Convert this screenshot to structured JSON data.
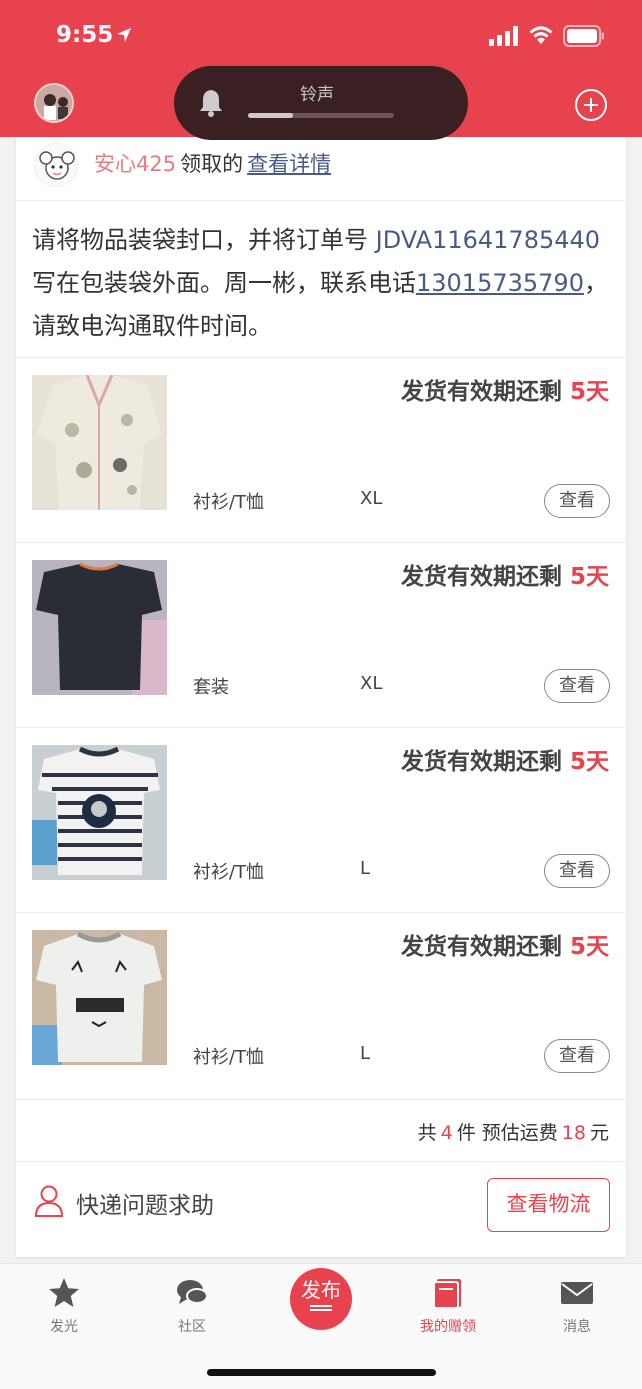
{
  "status_bar": {
    "time": "9:55"
  },
  "ringer_hud": {
    "label": "铃声",
    "level_fraction": 0.31
  },
  "claim": {
    "user": "安心425",
    "verb": "领取的",
    "link": "查看详情"
  },
  "instruction": {
    "text_before": "请将物品装袋封口，并将订单号 ",
    "order_number": "JDVA11641785440",
    "text_middle": " 写在包装袋外面。周一彬，联系电话",
    "phone": "13015735790",
    "text_after": "，请致电沟通取件时间。"
  },
  "items": [
    {
      "deadline_label": "发货有效期还剩",
      "days": "5天",
      "category": "衬衫/T恤",
      "size": "XL",
      "view_label": "查看"
    },
    {
      "deadline_label": "发货有效期还剩",
      "days": "5天",
      "category": "套装",
      "size": "XL",
      "view_label": "查看"
    },
    {
      "deadline_label": "发货有效期还剩",
      "days": "5天",
      "category": "衬衫/T恤",
      "size": "L",
      "view_label": "查看"
    },
    {
      "deadline_label": "发货有效期还剩",
      "days": "5天",
      "category": "衬衫/T恤",
      "size": "L",
      "view_label": "查看"
    }
  ],
  "summary": {
    "prefix": "共",
    "count": "4",
    "middle": "件 预估运费",
    "fee": "18",
    "suffix": "元"
  },
  "help": {
    "label": "快递问题求助",
    "logistics_button": "查看物流"
  },
  "tabs": [
    {
      "label": "发光",
      "icon": "star-icon"
    },
    {
      "label": "社区",
      "icon": "chat-bubbles-icon"
    },
    {
      "label": "发布",
      "icon": "publish-icon"
    },
    {
      "label": "我的赠领",
      "icon": "book-icon",
      "active": true
    },
    {
      "label": "消息",
      "icon": "mail-icon"
    }
  ],
  "colors": {
    "brand_red": "#e8424f",
    "link_blue": "#4a5a86"
  }
}
